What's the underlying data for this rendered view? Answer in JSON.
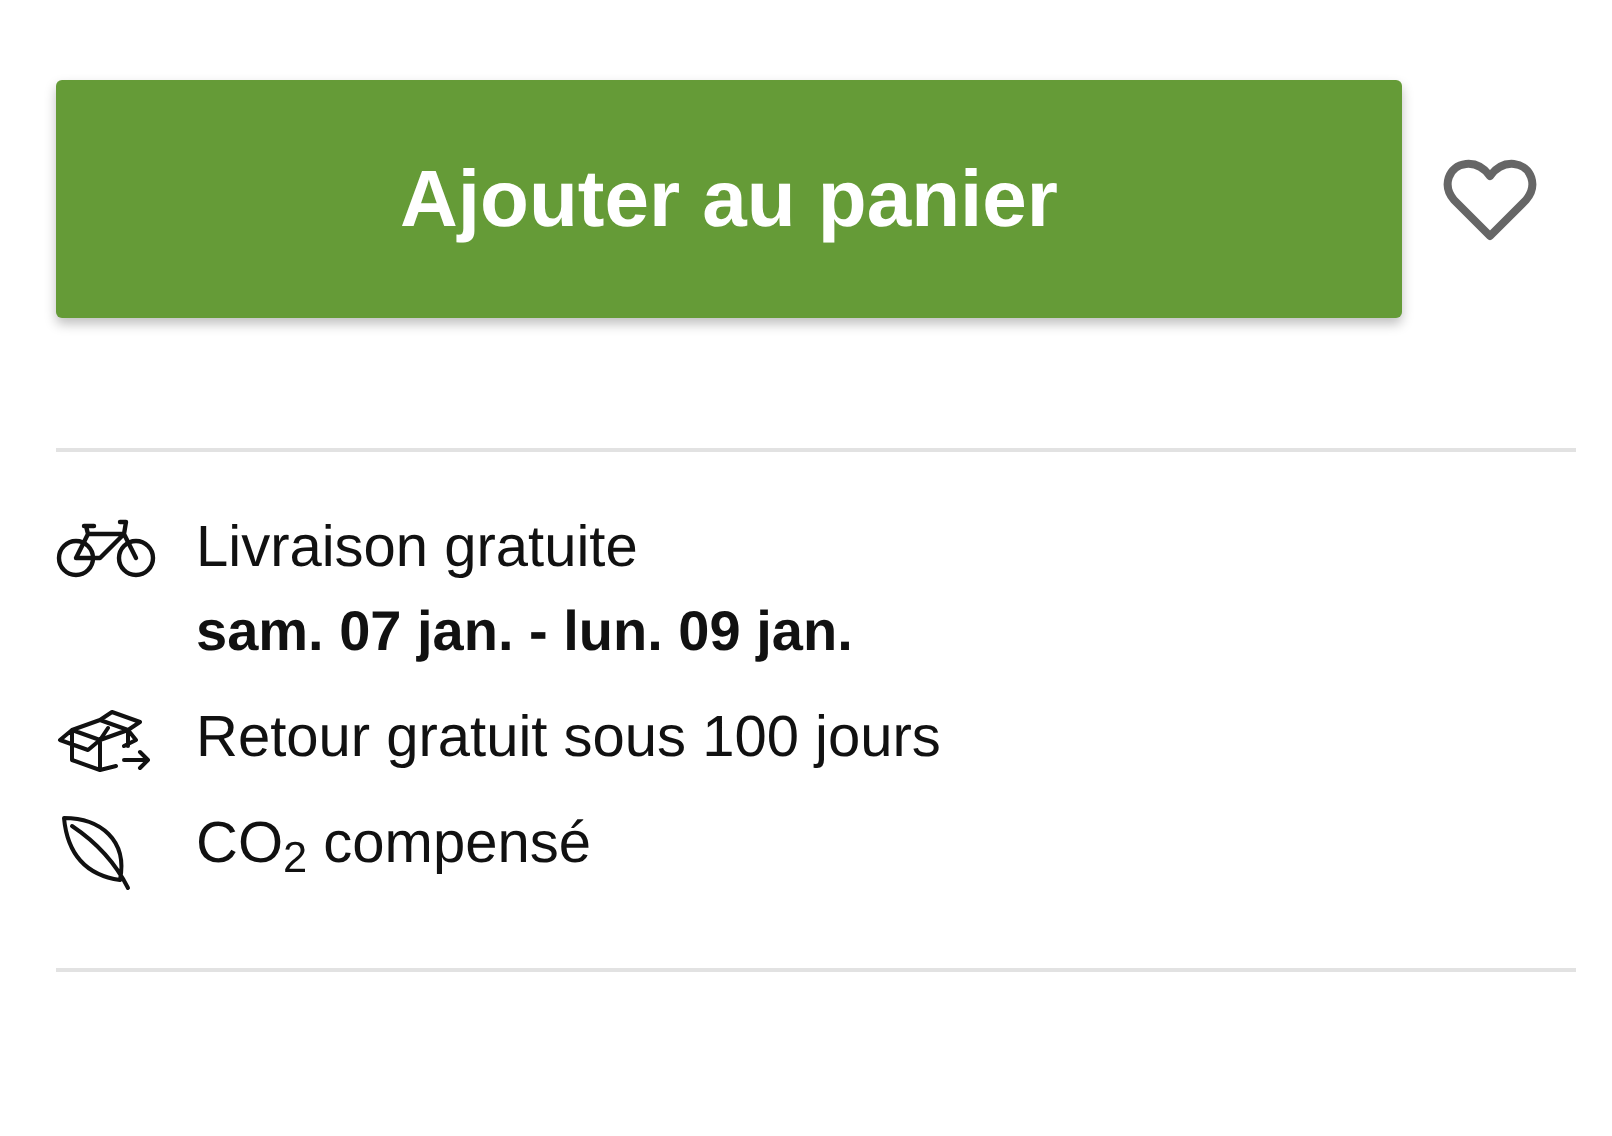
{
  "add_to_cart": {
    "label": "Ajouter au panier"
  },
  "wishlist": {
    "selected": false
  },
  "features": [
    {
      "kind": "bike",
      "title": "Livraison gratuite",
      "detail": "sam. 07 jan. - lun. 09 jan."
    },
    {
      "kind": "box",
      "title": "Retour gratuit sous 100 jours"
    },
    {
      "kind": "leaf",
      "title": "CO$_{2}$ compensé"
    }
  ]
}
